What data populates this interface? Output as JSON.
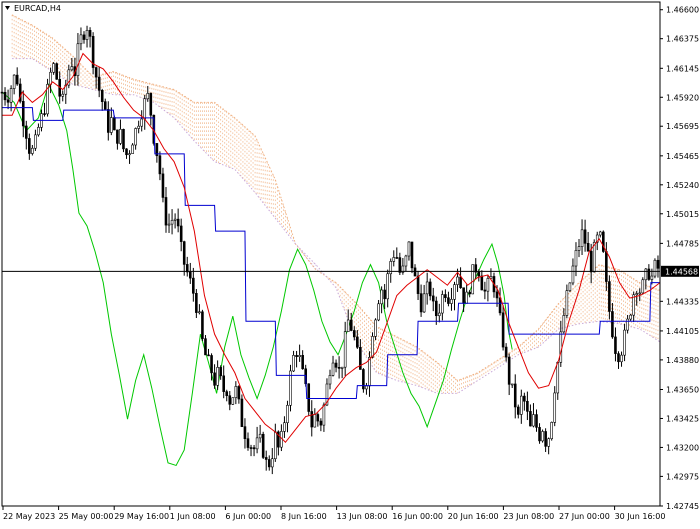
{
  "window": {
    "symbol_label": "EURCAD,H4",
    "menu_icon": "triangle-down-icon"
  },
  "price_tag": "1.44568",
  "colors": {
    "background": "#ffffff",
    "candles": "#000000",
    "axis": "#000000",
    "tenkan": "#e00000",
    "kijun": "#0000d0",
    "chikou": "#00c800",
    "cloud_bull": "#f0b080",
    "cloud_bear": "#c8a8d8"
  },
  "chart_data": {
    "type": "candlestick",
    "indicator": "Ichimoku Kinko Hyo",
    "ylim": [
      1.42745,
      1.4666
    ],
    "y_ticks": [
      "1.46600",
      "1.46375",
      "1.46145",
      "1.45920",
      "1.45695",
      "1.45465",
      "1.45240",
      "1.45015",
      "1.44785",
      "1.44335",
      "1.44105",
      "1.43880",
      "1.43650",
      "1.43425",
      "1.43200",
      "1.42975",
      "1.42745"
    ],
    "x_ticks": [
      "22 May 2023",
      "25 May 00:00",
      "29 May 16:00",
      "1 Jun 08:00",
      "6 Jun 00:00",
      "8 Jun 16:00",
      "13 Jun 08:00",
      "16 Jun 00:00",
      "20 Jun 16:00",
      "23 Jun 08:00",
      "27 Jun 00:00",
      "30 Jun 16:00"
    ],
    "current_price": 1.44568,
    "close_path": [
      [
        0,
        1.4596
      ],
      [
        5,
        1.4592
      ],
      [
        10,
        1.4602
      ],
      [
        14,
        1.4612
      ],
      [
        18,
        1.4588
      ],
      [
        22,
        1.4572
      ],
      [
        25,
        1.4562
      ],
      [
        28,
        1.4548
      ],
      [
        32,
        1.4552
      ],
      [
        36,
        1.4568
      ],
      [
        40,
        1.4578
      ],
      [
        44,
        1.4592
      ],
      [
        47,
        1.4606
      ],
      [
        50,
        1.4618
      ],
      [
        53,
        1.4612
      ],
      [
        56,
        1.4596
      ],
      [
        60,
        1.4588
      ],
      [
        64,
        1.4606
      ],
      [
        68,
        1.4622
      ],
      [
        72,
        1.4612
      ],
      [
        76,
        1.4632
      ],
      [
        80,
        1.4642
      ],
      [
        84,
        1.4648
      ],
      [
        88,
        1.4632
      ],
      [
        92,
        1.4612
      ],
      [
        96,
        1.4598
      ],
      [
        100,
        1.4586
      ],
      [
        104,
        1.4568
      ],
      [
        108,
        1.4574
      ],
      [
        112,
        1.4558
      ],
      [
        116,
        1.4566
      ],
      [
        120,
        1.4552
      ],
      [
        124,
        1.4546
      ],
      [
        128,
        1.4558
      ],
      [
        132,
        1.4566
      ],
      [
        136,
        1.4578
      ],
      [
        140,
        1.4586
      ],
      [
        144,
        1.4592
      ],
      [
        148,
        1.4576
      ],
      [
        150,
        1.4562
      ],
      [
        152,
        1.4552
      ],
      [
        155,
        1.4544
      ],
      [
        158,
        1.4512
      ],
      [
        162,
        1.4498
      ],
      [
        166,
        1.4492
      ],
      [
        170,
        1.4502
      ],
      [
        174,
        1.4488
      ],
      [
        178,
        1.4468
      ],
      [
        182,
        1.4458
      ],
      [
        186,
        1.4448
      ],
      [
        190,
        1.4438
      ],
      [
        194,
        1.4424
      ],
      [
        198,
        1.4402
      ],
      [
        202,
        1.4388
      ],
      [
        206,
        1.4382
      ],
      [
        210,
        1.4372
      ],
      [
        214,
        1.4378
      ],
      [
        218,
        1.4364
      ],
      [
        222,
        1.4366
      ],
      [
        226,
        1.4354
      ],
      [
        230,
        1.4368
      ],
      [
        234,
        1.4352
      ],
      [
        238,
        1.4336
      ],
      [
        242,
        1.4328
      ],
      [
        246,
        1.4322
      ],
      [
        250,
        1.4318
      ],
      [
        254,
        1.4326
      ],
      [
        258,
        1.4318
      ],
      [
        262,
        1.4304
      ],
      [
        266,
        1.4312
      ],
      [
        270,
        1.4328
      ],
      [
        274,
        1.4316
      ],
      [
        278,
        1.4336
      ],
      [
        282,
        1.4358
      ],
      [
        286,
        1.4382
      ],
      [
        290,
        1.4398
      ],
      [
        294,
        1.4388
      ],
      [
        298,
        1.4372
      ],
      [
        302,
        1.4356
      ],
      [
        306,
        1.4338
      ],
      [
        310,
        1.4346
      ],
      [
        314,
        1.4336
      ],
      [
        318,
        1.4352
      ],
      [
        322,
        1.4372
      ],
      [
        326,
        1.4394
      ],
      [
        330,
        1.4388
      ],
      [
        334,
        1.4376
      ],
      [
        338,
        1.4398
      ],
      [
        342,
        1.4418
      ],
      [
        346,
        1.4412
      ],
      [
        350,
        1.4396
      ],
      [
        354,
        1.4378
      ],
      [
        358,
        1.4366
      ],
      [
        362,
        1.4382
      ],
      [
        366,
        1.4412
      ],
      [
        370,
        1.4428
      ],
      [
        374,
        1.4446
      ],
      [
        378,
        1.4436
      ],
      [
        382,
        1.4458
      ],
      [
        386,
        1.4472
      ],
      [
        390,
        1.4468
      ],
      [
        394,
        1.4452
      ],
      [
        398,
        1.4462
      ],
      [
        402,
        1.4476
      ],
      [
        406,
        1.4458
      ],
      [
        410,
        1.4442
      ],
      [
        414,
        1.4432
      ],
      [
        418,
        1.4438
      ],
      [
        422,
        1.4446
      ],
      [
        426,
        1.4428
      ],
      [
        430,
        1.4422
      ],
      [
        434,
        1.4436
      ],
      [
        438,
        1.4442
      ],
      [
        442,
        1.4436
      ],
      [
        446,
        1.4448
      ],
      [
        450,
        1.4456
      ],
      [
        454,
        1.4442
      ],
      [
        458,
        1.4432
      ],
      [
        462,
        1.4446
      ],
      [
        466,
        1.4458
      ],
      [
        470,
        1.4462
      ],
      [
        474,
        1.4448
      ],
      [
        478,
        1.4438
      ],
      [
        482,
        1.4452
      ],
      [
        486,
        1.4446
      ],
      [
        490,
        1.4428
      ],
      [
        494,
        1.4408
      ],
      [
        498,
        1.4386
      ],
      [
        502,
        1.4368
      ],
      [
        506,
        1.4358
      ],
      [
        510,
        1.4342
      ],
      [
        514,
        1.4362
      ],
      [
        518,
        1.4348
      ],
      [
        522,
        1.4334
      ],
      [
        526,
        1.4344
      ],
      [
        530,
        1.4328
      ],
      [
        534,
        1.4336
      ],
      [
        538,
        1.4322
      ],
      [
        542,
        1.4336
      ],
      [
        546,
        1.4368
      ],
      [
        550,
        1.4392
      ],
      [
        554,
        1.4418
      ],
      [
        558,
        1.4436
      ],
      [
        562,
        1.4452
      ],
      [
        566,
        1.4466
      ],
      [
        570,
        1.4478
      ],
      [
        574,
        1.4488
      ],
      [
        578,
        1.4472
      ],
      [
        582,
        1.4462
      ],
      [
        586,
        1.4476
      ],
      [
        590,
        1.4486
      ],
      [
        594,
        1.4468
      ],
      [
        598,
        1.4436
      ],
      [
        602,
        1.4416
      ],
      [
        606,
        1.4398
      ],
      [
        610,
        1.4392
      ],
      [
        614,
        1.4402
      ],
      [
        618,
        1.4416
      ],
      [
        622,
        1.4432
      ],
      [
        626,
        1.4448
      ],
      [
        630,
        1.4442
      ],
      [
        634,
        1.4446
      ],
      [
        638,
        1.4458
      ],
      [
        642,
        1.4452
      ],
      [
        646,
        1.4462
      ],
      [
        650,
        1.4456
      ]
    ],
    "tenkan": [
      [
        0,
        1.4578
      ],
      [
        10,
        1.4578
      ],
      [
        20,
        1.4596
      ],
      [
        30,
        1.4588
      ],
      [
        40,
        1.4594
      ],
      [
        50,
        1.4604
      ],
      [
        60,
        1.4598
      ],
      [
        70,
        1.4608
      ],
      [
        80,
        1.4626
      ],
      [
        90,
        1.4618
      ],
      [
        100,
        1.4614
      ],
      [
        110,
        1.4604
      ],
      [
        120,
        1.4592
      ],
      [
        130,
        1.4582
      ],
      [
        140,
        1.4576
      ],
      [
        150,
        1.4566
      ],
      [
        160,
        1.4552
      ],
      [
        170,
        1.4542
      ],
      [
        180,
        1.4522
      ],
      [
        190,
        1.4488
      ],
      [
        200,
        1.4438
      ],
      [
        210,
        1.4408
      ],
      [
        220,
        1.4392
      ],
      [
        230,
        1.4378
      ],
      [
        240,
        1.4358
      ],
      [
        250,
        1.4348
      ],
      [
        260,
        1.4338
      ],
      [
        270,
        1.4332
      ],
      [
        280,
        1.4324
      ],
      [
        290,
        1.4334
      ],
      [
        300,
        1.4344
      ],
      [
        310,
        1.4346
      ],
      [
        320,
        1.4354
      ],
      [
        330,
        1.4366
      ],
      [
        340,
        1.4376
      ],
      [
        350,
        1.4382
      ],
      [
        360,
        1.4386
      ],
      [
        370,
        1.4394
      ],
      [
        380,
        1.4416
      ],
      [
        390,
        1.4438
      ],
      [
        400,
        1.4446
      ],
      [
        410,
        1.4452
      ],
      [
        420,
        1.4458
      ],
      [
        430,
        1.4452
      ],
      [
        440,
        1.4446
      ],
      [
        450,
        1.4456
      ],
      [
        460,
        1.4446
      ],
      [
        470,
        1.4452
      ],
      [
        480,
        1.4454
      ],
      [
        490,
        1.4442
      ],
      [
        500,
        1.4418
      ],
      [
        510,
        1.4398
      ],
      [
        520,
        1.4378
      ],
      [
        530,
        1.4366
      ],
      [
        540,
        1.4368
      ],
      [
        550,
        1.4388
      ],
      [
        560,
        1.4418
      ],
      [
        570,
        1.4442
      ],
      [
        580,
        1.4472
      ],
      [
        590,
        1.4482
      ],
      [
        600,
        1.4468
      ],
      [
        610,
        1.4448
      ],
      [
        620,
        1.4436
      ],
      [
        630,
        1.4438
      ],
      [
        640,
        1.4442
      ],
      [
        650,
        1.4448
      ]
    ],
    "kijun": [
      [
        0,
        1.4584
      ],
      [
        30,
        1.4584
      ],
      [
        31,
        1.4574
      ],
      [
        60,
        1.4574
      ],
      [
        61,
        1.4582
      ],
      [
        110,
        1.4582
      ],
      [
        111,
        1.4576
      ],
      [
        150,
        1.4576
      ],
      [
        151,
        1.4548
      ],
      [
        180,
        1.4548
      ],
      [
        181,
        1.4508
      ],
      [
        210,
        1.4508
      ],
      [
        211,
        1.4488
      ],
      [
        240,
        1.4488
      ],
      [
        241,
        1.4418
      ],
      [
        270,
        1.4418
      ],
      [
        271,
        1.4376
      ],
      [
        300,
        1.4376
      ],
      [
        301,
        1.4358
      ],
      [
        350,
        1.4358
      ],
      [
        351,
        1.4368
      ],
      [
        380,
        1.4368
      ],
      [
        381,
        1.4392
      ],
      [
        410,
        1.4392
      ],
      [
        411,
        1.4418
      ],
      [
        450,
        1.4418
      ],
      [
        451,
        1.4432
      ],
      [
        500,
        1.4432
      ],
      [
        501,
        1.4408
      ],
      [
        590,
        1.4408
      ],
      [
        591,
        1.4418
      ],
      [
        640,
        1.4418
      ],
      [
        641,
        1.4448
      ],
      [
        650,
        1.4448
      ]
    ],
    "chikou": [
      [
        0,
        1.4596
      ],
      [
        12,
        1.4588
      ],
      [
        24,
        1.4566
      ],
      [
        36,
        1.4576
      ],
      [
        46,
        1.4602
      ],
      [
        56,
        1.4586
      ],
      [
        64,
        1.4566
      ],
      [
        70,
        1.4536
      ],
      [
        76,
        1.4502
      ],
      [
        84,
        1.4492
      ],
      [
        92,
        1.4472
      ],
      [
        100,
        1.4448
      ],
      [
        108,
        1.4408
      ],
      [
        116,
        1.4376
      ],
      [
        124,
        1.4342
      ],
      [
        132,
        1.4372
      ],
      [
        140,
        1.4392
      ],
      [
        148,
        1.4366
      ],
      [
        156,
        1.4336
      ],
      [
        164,
        1.4308
      ],
      [
        172,
        1.4306
      ],
      [
        180,
        1.4318
      ],
      [
        188,
        1.4362
      ],
      [
        196,
        1.4408
      ],
      [
        204,
        1.4386
      ],
      [
        212,
        1.4362
      ],
      [
        220,
        1.4398
      ],
      [
        228,
        1.4422
      ],
      [
        236,
        1.4392
      ],
      [
        244,
        1.4374
      ],
      [
        252,
        1.4358
      ],
      [
        260,
        1.4376
      ],
      [
        268,
        1.4398
      ],
      [
        276,
        1.4426
      ],
      [
        284,
        1.4458
      ],
      [
        292,
        1.4474
      ],
      [
        300,
        1.4462
      ],
      [
        308,
        1.4442
      ],
      [
        316,
        1.4418
      ],
      [
        324,
        1.4402
      ],
      [
        332,
        1.4392
      ],
      [
        340,
        1.4408
      ],
      [
        348,
        1.4426
      ],
      [
        356,
        1.4448
      ],
      [
        364,
        1.4462
      ],
      [
        372,
        1.4448
      ],
      [
        380,
        1.4418
      ],
      [
        388,
        1.4398
      ],
      [
        396,
        1.4378
      ],
      [
        404,
        1.4362
      ],
      [
        412,
        1.4352
      ],
      [
        420,
        1.4336
      ],
      [
        428,
        1.4354
      ],
      [
        436,
        1.4372
      ],
      [
        444,
        1.4396
      ],
      [
        452,
        1.4418
      ],
      [
        460,
        1.4438
      ],
      [
        468,
        1.4452
      ],
      [
        476,
        1.4466
      ],
      [
        484,
        1.4478
      ],
      [
        490,
        1.4462
      ],
      [
        496,
        1.4438
      ],
      [
        500,
        1.4412
      ],
      [
        504,
        1.4396
      ]
    ],
    "span_a": [
      [
        10,
        1.4656
      ],
      [
        30,
        1.4648
      ],
      [
        50,
        1.4638
      ],
      [
        70,
        1.4624
      ],
      [
        90,
        1.4608
      ],
      [
        110,
        1.4612
      ],
      [
        130,
        1.4606
      ],
      [
        150,
        1.4602
      ],
      [
        170,
        1.4598
      ],
      [
        190,
        1.4588
      ],
      [
        210,
        1.4588
      ],
      [
        230,
        1.4576
      ],
      [
        250,
        1.4562
      ],
      [
        270,
        1.4528
      ],
      [
        290,
        1.4478
      ],
      [
        310,
        1.4458
      ],
      [
        330,
        1.4448
      ],
      [
        350,
        1.4432
      ],
      [
        370,
        1.4414
      ],
      [
        390,
        1.4406
      ],
      [
        410,
        1.4398
      ],
      [
        430,
        1.4386
      ],
      [
        450,
        1.4372
      ],
      [
        470,
        1.4378
      ],
      [
        490,
        1.4388
      ],
      [
        510,
        1.4398
      ],
      [
        530,
        1.4412
      ],
      [
        550,
        1.4432
      ],
      [
        570,
        1.4448
      ],
      [
        590,
        1.4462
      ],
      [
        610,
        1.4458
      ],
      [
        630,
        1.4448
      ],
      [
        650,
        1.4442
      ]
    ],
    "span_b": [
      [
        10,
        1.4622
      ],
      [
        30,
        1.4622
      ],
      [
        50,
        1.4612
      ],
      [
        70,
        1.4602
      ],
      [
        90,
        1.4598
      ],
      [
        110,
        1.4594
      ],
      [
        130,
        1.4594
      ],
      [
        150,
        1.4588
      ],
      [
        170,
        1.4576
      ],
      [
        190,
        1.4558
      ],
      [
        210,
        1.4542
      ],
      [
        230,
        1.4536
      ],
      [
        250,
        1.4518
      ],
      [
        270,
        1.4498
      ],
      [
        290,
        1.4478
      ],
      [
        310,
        1.4462
      ],
      [
        330,
        1.4444
      ],
      [
        350,
        1.4402
      ],
      [
        370,
        1.4378
      ],
      [
        390,
        1.4372
      ],
      [
        410,
        1.4368
      ],
      [
        430,
        1.4362
      ],
      [
        450,
        1.4362
      ],
      [
        470,
        1.4372
      ],
      [
        490,
        1.4382
      ],
      [
        510,
        1.4392
      ],
      [
        530,
        1.4398
      ],
      [
        550,
        1.4412
      ],
      [
        570,
        1.4416
      ],
      [
        590,
        1.4418
      ],
      [
        610,
        1.4416
      ],
      [
        630,
        1.4412
      ],
      [
        650,
        1.4402
      ]
    ]
  }
}
